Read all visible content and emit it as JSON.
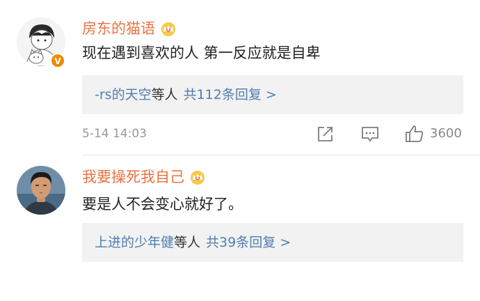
{
  "comments": [
    {
      "username": "房东的猫语",
      "text": "现在遇到喜欢的人 第一反应就是自卑",
      "replies": {
        "nickname": "-rs的天空",
        "suffix": "等人",
        "count_text": "共112条回复 >"
      },
      "timestamp": "5-14 14:03",
      "likes": "3600",
      "avatar_icon": "cartoon-boy-with-cat-icon",
      "badge_icon": "verified-badge-icon"
    },
    {
      "username": "我要操死我自己",
      "text": "要是人不会变心就好了。",
      "replies": {
        "nickname": "上进的少年健",
        "suffix": "等人",
        "count_text": "共39条回复 >"
      },
      "avatar_icon": "man-portrait-icon"
    }
  ],
  "colors": {
    "username": "#eb7340",
    "link": "#507daf",
    "meta": "#999999",
    "reply_bg": "#f2f2f2"
  }
}
